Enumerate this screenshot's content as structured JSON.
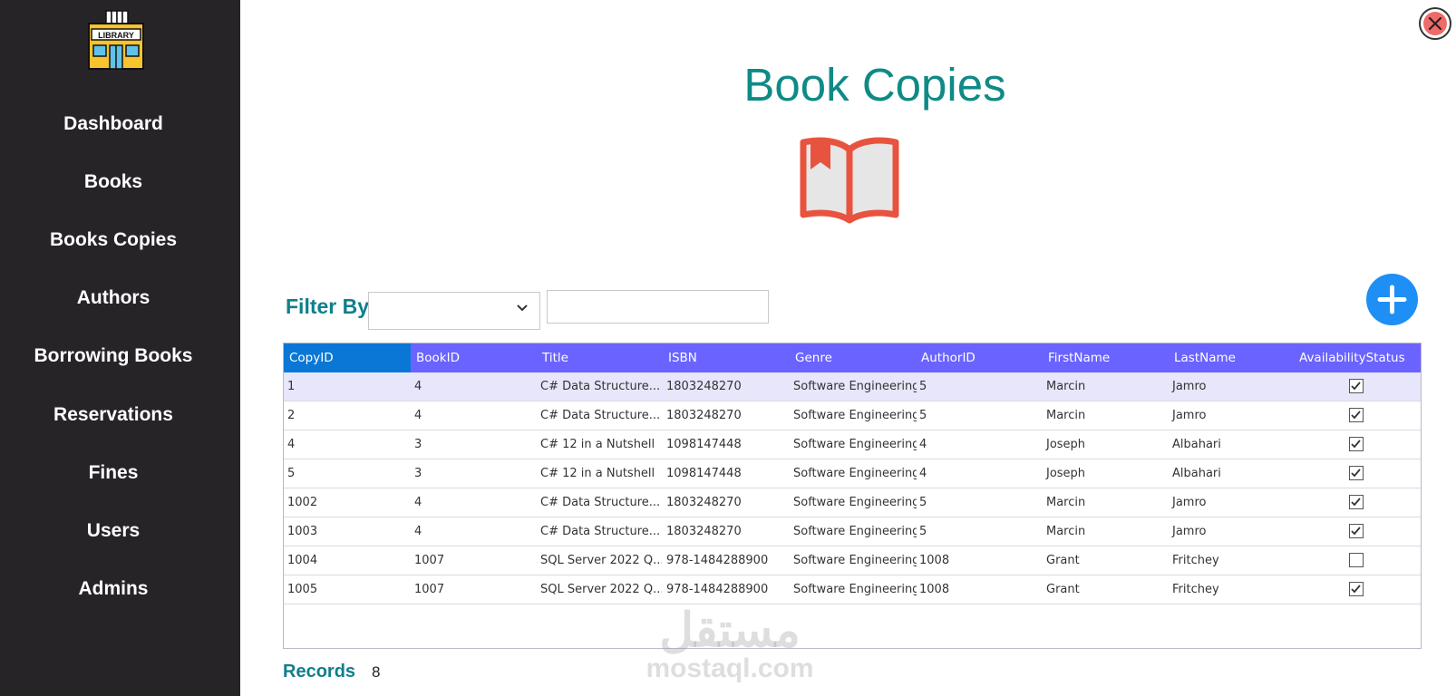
{
  "sidebar": {
    "logo_text": "LIBRARY",
    "items": [
      {
        "label": "Dashboard"
      },
      {
        "label": "Books"
      },
      {
        "label": "Books Copies"
      },
      {
        "label": "Authors"
      },
      {
        "label": "Borrowing Books"
      },
      {
        "label": "Reservations"
      },
      {
        "label": "Fines"
      },
      {
        "label": "Users"
      },
      {
        "label": "Admins"
      }
    ]
  },
  "page": {
    "title": "Book Copies",
    "icon": "open-book-icon",
    "close_icon": "close-icon"
  },
  "filter": {
    "label": "Filter By",
    "select_value": "",
    "input_value": ""
  },
  "add_button_icon": "plus-icon",
  "grid": {
    "columns": [
      "CopyID",
      "BookID",
      "Title",
      "ISBN",
      "Genre",
      "AuthorID",
      "FirstName",
      "LastName",
      "AvailabilityStatus"
    ],
    "rows": [
      {
        "CopyID": "1",
        "BookID": "4",
        "Title": "C# Data Structure...",
        "ISBN": "1803248270",
        "Genre": "Software Engineering",
        "AuthorID": "5",
        "FirstName": "Marcin",
        "LastName": "Jamro",
        "Available": true
      },
      {
        "CopyID": "2",
        "BookID": "4",
        "Title": "C# Data Structure...",
        "ISBN": "1803248270",
        "Genre": "Software Engineering",
        "AuthorID": "5",
        "FirstName": "Marcin",
        "LastName": "Jamro",
        "Available": true
      },
      {
        "CopyID": "4",
        "BookID": "3",
        "Title": "C# 12 in a Nutshell",
        "ISBN": "1098147448",
        "Genre": "Software Engineering",
        "AuthorID": "4",
        "FirstName": "Joseph",
        "LastName": "Albahari",
        "Available": true
      },
      {
        "CopyID": "5",
        "BookID": "3",
        "Title": "C# 12 in a Nutshell",
        "ISBN": "1098147448",
        "Genre": "Software Engineering",
        "AuthorID": "4",
        "FirstName": "Joseph",
        "LastName": "Albahari",
        "Available": true
      },
      {
        "CopyID": "1002",
        "BookID": "4",
        "Title": "C# Data Structure...",
        "ISBN": "1803248270",
        "Genre": "Software Engineering",
        "AuthorID": "5",
        "FirstName": "Marcin",
        "LastName": "Jamro",
        "Available": true
      },
      {
        "CopyID": "1003",
        "BookID": "4",
        "Title": "C# Data Structure...",
        "ISBN": "1803248270",
        "Genre": "Software Engineering",
        "AuthorID": "5",
        "FirstName": "Marcin",
        "LastName": "Jamro",
        "Available": true
      },
      {
        "CopyID": "1004",
        "BookID": "1007",
        "Title": "SQL Server 2022 Q...",
        "ISBN": "978-1484288900",
        "Genre": "Software Engineering",
        "AuthorID": "1008",
        "FirstName": "Grant",
        "LastName": "Fritchey",
        "Available": false
      },
      {
        "CopyID": "1005",
        "BookID": "1007",
        "Title": "SQL Server 2022 Q...",
        "ISBN": "978-1484288900",
        "Genre": "Software Engineering",
        "AuthorID": "1008",
        "FirstName": "Grant",
        "LastName": "Fritchey",
        "Available": true
      }
    ]
  },
  "records": {
    "label": "Records",
    "count": "8"
  },
  "watermark": {
    "arabic": "مستقل",
    "latin": "mostaql.com"
  },
  "colors": {
    "sidebar_bg": "#272427",
    "title": "#0f8a86",
    "header_bg": "#6a63ff",
    "header_active": "#0a77d6",
    "selected_row": "#e7e6fb",
    "add_button": "#1e8ff5",
    "book_icon": "#e8533f"
  }
}
